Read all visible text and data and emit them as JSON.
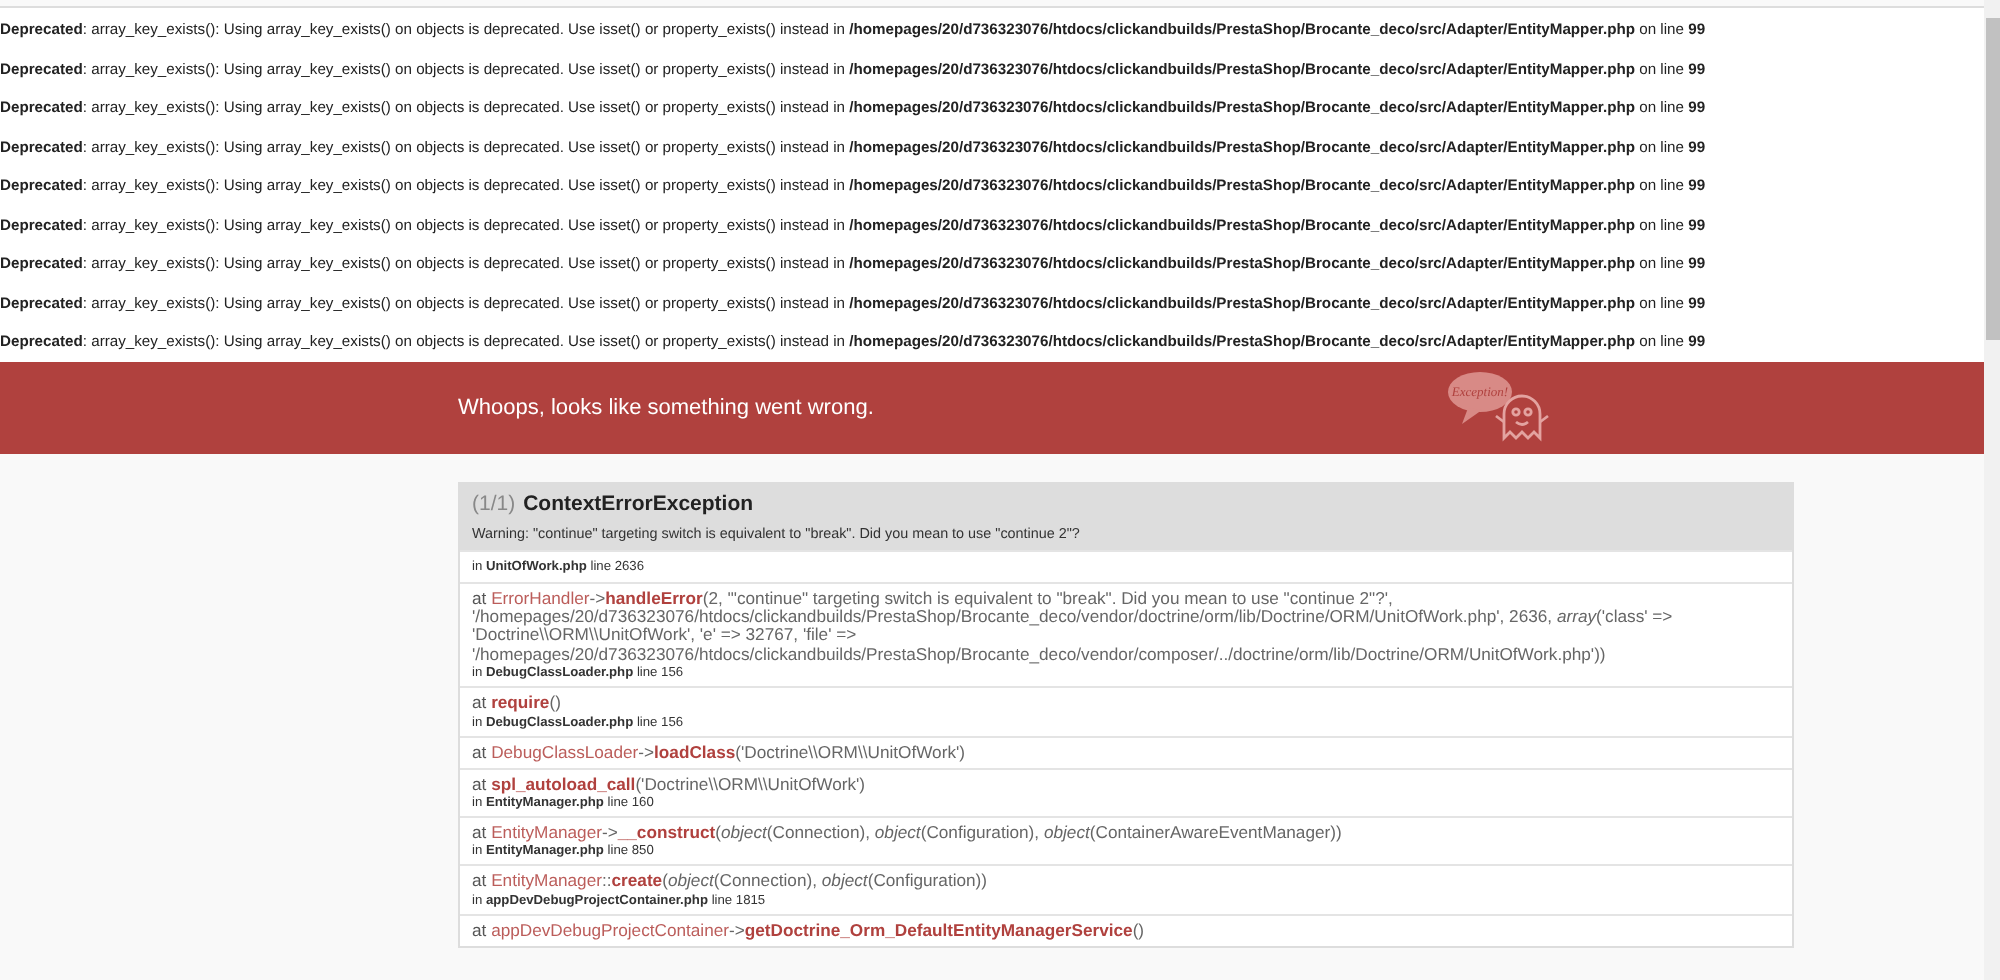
{
  "deprecations": [
    "**Deprecated**: array_key_exists(): Using array_key_exists() on objects is deprecated. Use isset() or property_exists() instead in **/homepages/20/d736323076/htdocs/clickandbuilds/PrestaShop/Brocante_deco/src/Adapter/EntityMapper.php** on line **99**",
    "**Deprecated**: array_key_exists(): Using array_key_exists() on objects is deprecated. Use isset() or property_exists() instead in **/homepages/20/d736323076/htdocs/clickandbuilds/PrestaShop/Brocante_deco/src/Adapter/EntityMapper.php** on line **99**",
    "**Deprecated**: array_key_exists(): Using array_key_exists() on objects is deprecated. Use isset() or property_exists() instead in **/homepages/20/d736323076/htdocs/clickandbuilds/PrestaShop/Brocante_deco/src/Adapter/EntityMapper.php** on line **99**",
    "**Deprecated**: array_key_exists(): Using array_key_exists() on objects is deprecated. Use isset() or property_exists() instead in **/homepages/20/d736323076/htdocs/clickandbuilds/PrestaShop/Brocante_deco/src/Adapter/EntityMapper.php** on line **99**",
    "**Deprecated**: array_key_exists(): Using array_key_exists() on objects is deprecated. Use isset() or property_exists() instead in **/homepages/20/d736323076/htdocs/clickandbuilds/PrestaShop/Brocante_deco/src/Adapter/EntityMapper.php** on line **99**",
    "**Deprecated**: array_key_exists(): Using array_key_exists() on objects is deprecated. Use isset() or property_exists() instead in **/homepages/20/d736323076/htdocs/clickandbuilds/PrestaShop/Brocante_deco/src/Adapter/EntityMapper.php** on line **99**",
    "**Deprecated**: array_key_exists(): Using array_key_exists() on objects is deprecated. Use isset() or property_exists() instead in **/homepages/20/d736323076/htdocs/clickandbuilds/PrestaShop/Brocante_deco/src/Adapter/EntityMapper.php** on line **99**",
    "**Deprecated**: array_key_exists(): Using array_key_exists() on objects is deprecated. Use isset() or property_exists() instead in **/homepages/20/d736323076/htdocs/clickandbuilds/PrestaShop/Brocante_deco/src/Adapter/EntityMapper.php** on line **99**",
    "**Deprecated**: array_key_exists(): Using array_key_exists() on objects is deprecated. Use isset() or property_exists() instead in **/homepages/20/d736323076/htdocs/clickandbuilds/PrestaShop/Brocante_deco/src/Adapter/EntityMapper.php** on line **99**"
  ],
  "banner": {
    "title": "Whoops, looks like something went wrong.",
    "logo_text": "Exception!"
  },
  "exception": {
    "count": "(1/1)",
    "name": "ContextErrorException",
    "message": "Warning: \"continue\" targeting switch is equivalent to \"break\". Did you mean to use \"continue 2\"?"
  },
  "trace": [
    {
      "file": "in **UnitOfWork.php** line 2636"
    },
    {
      "at": "at",
      "class": "ErrorHandler",
      "type": "->",
      "function": "handleError",
      "args": "(2, '\"continue\" targeting switch is equivalent to \"break\". Did you mean to use \"continue 2\"?', '/homepages/20/d736323076/htdocs/clickandbuilds/PrestaShop/Brocante_deco/vendor/doctrine/orm/lib/Doctrine/ORM/UnitOfWork.php', 2636, *array*('class' => 'Doctrine\\\\ORM\\\\UnitOfWork', 'e' => 32767, 'file' => '/homepages/20/d736323076/htdocs/clickandbuilds/PrestaShop/Brocante_deco/vendor/composer/../doctrine/orm/lib/Doctrine/ORM/UnitOfWork.php'))",
      "file": "in **DebugClassLoader.php** line 156"
    },
    {
      "at": "at",
      "function": "require",
      "args": "()",
      "file": "in **DebugClassLoader.php** line 156"
    },
    {
      "at": "at",
      "class": "DebugClassLoader",
      "type": "->",
      "function": "loadClass",
      "args": "('Doctrine\\\\ORM\\\\UnitOfWork')"
    },
    {
      "at": "at",
      "function": "spl_autoload_call",
      "args": "('Doctrine\\\\ORM\\\\UnitOfWork')",
      "file": "in **EntityManager.php** line 160"
    },
    {
      "at": "at",
      "class": "EntityManager",
      "type": "->",
      "function": "__construct",
      "args": "(*object*(Connection), *object*(Configuration), *object*(ContainerAwareEventManager))",
      "file": "in **EntityManager.php** line 850"
    },
    {
      "at": "at",
      "class": "EntityManager",
      "type": "::",
      "function": "create",
      "args": "(*object*(Connection), *object*(Configuration))",
      "file": "in **appDevDebugProjectContainer.php** line 1815"
    },
    {
      "at": "at",
      "class": "appDevDebugProjectContainer",
      "type": "->",
      "function": "getDoctrine_Orm_DefaultEntityManagerService",
      "args": "()"
    }
  ]
}
